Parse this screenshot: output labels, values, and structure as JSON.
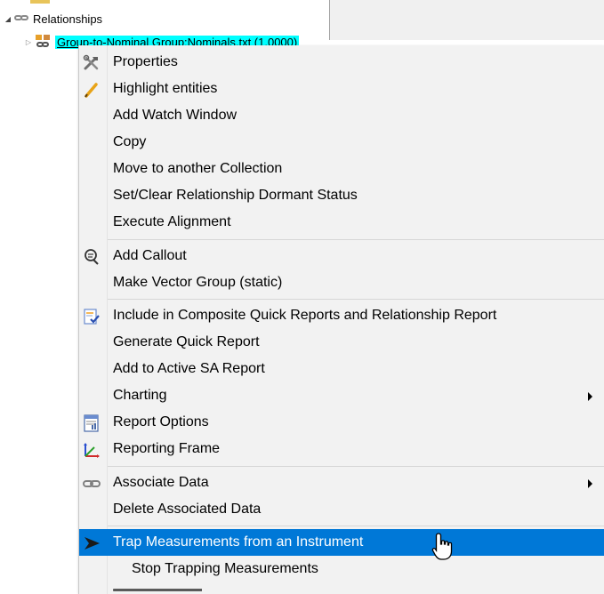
{
  "tree": {
    "relationships_label": "Relationships",
    "selected_item": "Group-to-Nominal Group:Nominals.txt (1.0000)"
  },
  "menu": {
    "items": [
      {
        "label": "Properties",
        "icon": "tools-icon"
      },
      {
        "label": "Highlight entities",
        "icon": "pencil-icon"
      },
      {
        "label": "Add Watch Window"
      },
      {
        "label": "Copy"
      },
      {
        "label": "Move to another Collection"
      },
      {
        "label": "Set/Clear Relationship Dormant Status"
      },
      {
        "label": "Execute Alignment"
      },
      {
        "label": "Add Callout",
        "icon": "callout-icon"
      },
      {
        "label": "Make Vector Group (static)"
      },
      {
        "label": "Include in Composite Quick Reports and Relationship Report",
        "icon": "report-check-icon"
      },
      {
        "label": "Generate Quick Report"
      },
      {
        "label": "Add to Active SA Report"
      },
      {
        "label": "Charting",
        "submenu": true
      },
      {
        "label": "Report Options",
        "icon": "report-options-icon"
      },
      {
        "label": "Reporting Frame",
        "icon": "frame-axes-icon"
      },
      {
        "label": "Associate Data",
        "icon": "link-icon",
        "submenu": true
      },
      {
        "label": "Delete Associated Data"
      },
      {
        "label": "Trap Measurements from an Instrument",
        "icon": "arrow-icon",
        "highlighted": true
      },
      {
        "label": "Stop Trapping Measurements"
      }
    ]
  },
  "colors": {
    "highlight": "#0078d7",
    "selection": "#00ffff",
    "menu_bg": "#f2f2f2"
  }
}
